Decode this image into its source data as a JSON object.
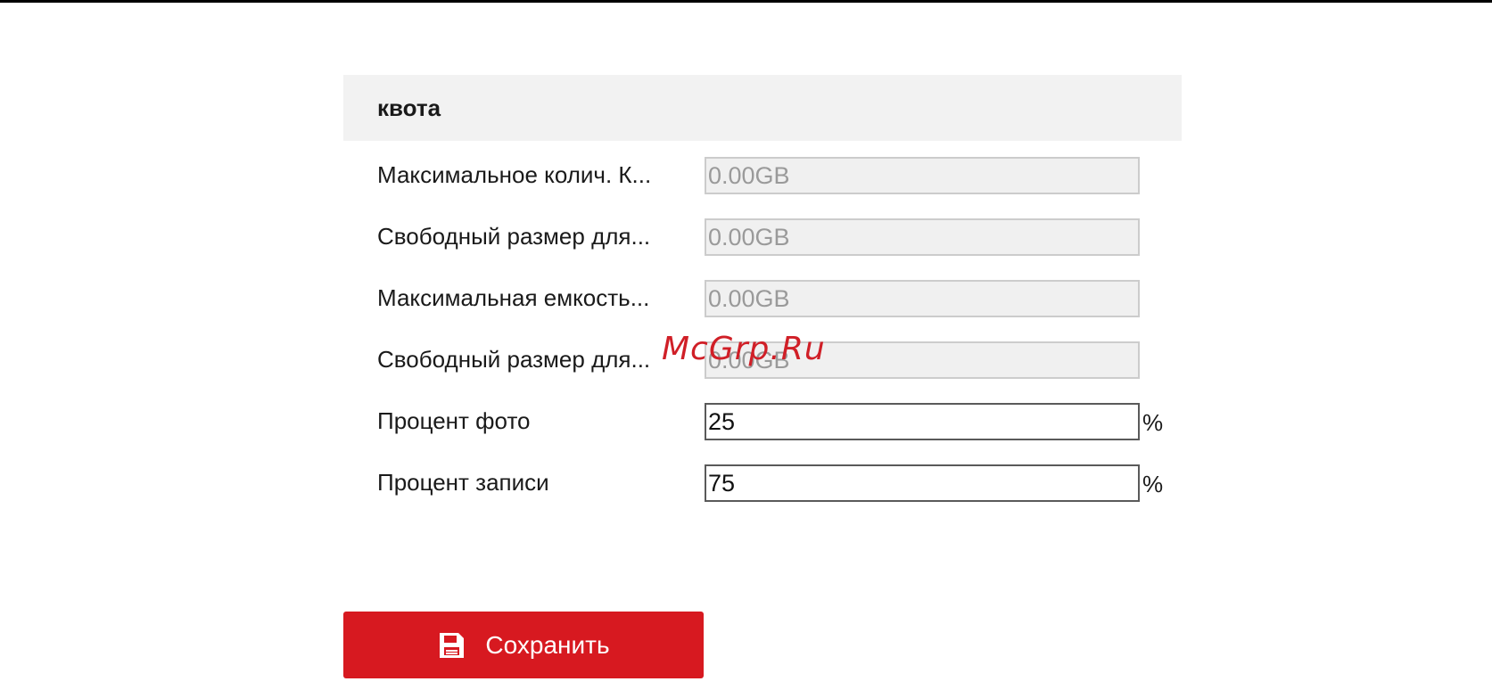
{
  "panel": {
    "title": "квота"
  },
  "fields": [
    {
      "label": "Максимальное колич. К...",
      "value": "0.00GB",
      "editable": false,
      "unit": ""
    },
    {
      "label": "Свободный размер для...",
      "value": "0.00GB",
      "editable": false,
      "unit": ""
    },
    {
      "label": "Максимальная емкость...",
      "value": "0.00GB",
      "editable": false,
      "unit": ""
    },
    {
      "label": "Свободный размер для...",
      "value": "0.00GB",
      "editable": false,
      "unit": ""
    },
    {
      "label": "Процент фото",
      "value": "25",
      "editable": true,
      "unit": "%"
    },
    {
      "label": "Процент записи",
      "value": "75",
      "editable": true,
      "unit": "%"
    }
  ],
  "save_button": {
    "label": "Сохранить",
    "icon": "floppy-disk-icon"
  },
  "watermark": "McGrp.Ru",
  "colors": {
    "accent": "#d71920",
    "header_bg": "#f2f2f2",
    "disabled_input_bg": "#f0f0f0"
  }
}
